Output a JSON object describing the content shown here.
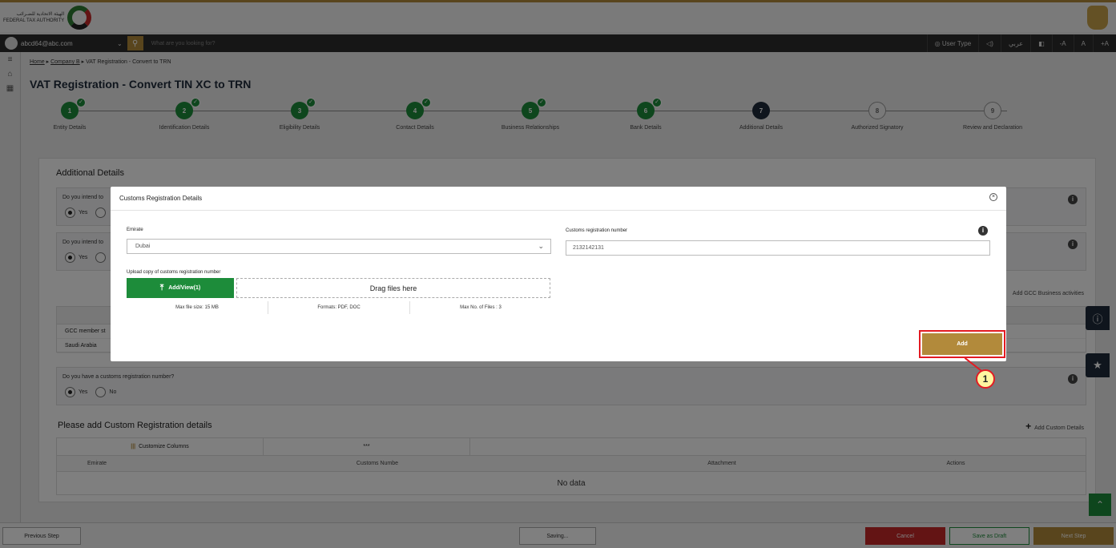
{
  "header": {
    "logo_text_line1": "الهيئة الاتحادية للضـرائب",
    "logo_text_line2": "FEDERAL TAX AUTHORITY"
  },
  "userbar": {
    "email": "abcd64@abc.com",
    "search_placeholder": "What are you looking for?",
    "user_type": "User Type",
    "language": "عربي",
    "font_small": "-A",
    "font_normal": "A",
    "font_large": "+A"
  },
  "breadcrumb": {
    "home": "Home",
    "company": "Company B",
    "current": "VAT Registration - Convert to TRN"
  },
  "page_title": "VAT Registration - Convert TIN XC to TRN",
  "steps": [
    {
      "num": "1",
      "label": "Entity Details",
      "state": "done"
    },
    {
      "num": "2",
      "label": "Identification Details",
      "state": "done"
    },
    {
      "num": "3",
      "label": "Eligibility Details",
      "state": "done"
    },
    {
      "num": "4",
      "label": "Contact Details",
      "state": "done"
    },
    {
      "num": "5",
      "label": "Business Relationships",
      "state": "done"
    },
    {
      "num": "6",
      "label": "Bank Details",
      "state": "done"
    },
    {
      "num": "7",
      "label": "Additional Details",
      "state": "current"
    },
    {
      "num": "8",
      "label": "Authorized Signatory",
      "state": "todo"
    },
    {
      "num": "9",
      "label": "Review and Declaration",
      "state": "todo"
    }
  ],
  "additional": {
    "title": "Additional Details",
    "q1": "Do you intend to",
    "q2": "Do you intend to",
    "yes": "Yes",
    "no": "No",
    "gcc_link": "Add GCC Business activities",
    "gcc_col": "GCC member st",
    "gcc_value": "Saudi Arabia",
    "q3": "Do you have a customs registration number?"
  },
  "custom_section": {
    "title": "Please add Custom Registration details",
    "add_link": "Add Custom Details",
    "customize_columns": "Customize Columns",
    "search_stars": "***",
    "columns": [
      "Emirate",
      "Customs Numbe",
      "Attachment",
      "Actions"
    ],
    "no_data": "No data"
  },
  "footer": {
    "previous": "Previous Step",
    "saving": "Saving...",
    "cancel": "Cancel",
    "save_draft": "Save as Draft",
    "next": "Next Step"
  },
  "modal": {
    "title": "Customs Registration Details",
    "emirate_label": "Emirate",
    "emirate_value": "Dubai",
    "customs_label": "Customs registration number",
    "customs_value": "2132142131",
    "upload_label": "Upload copy of customs registration number",
    "upload_btn": "Add/View(1)",
    "drop_text": "Drag files here",
    "max_size": "Max file size: 15 MB",
    "formats": "Formats: PDF, DOC",
    "max_files": "Max No. of Files : 3",
    "add_btn": "Add"
  },
  "callout_number": "1",
  "colors": {
    "brand_gold": "#b28a3b",
    "success_green": "#1d8c3a",
    "navy": "#1f2b3a",
    "highlight_red": "#e31b23"
  }
}
